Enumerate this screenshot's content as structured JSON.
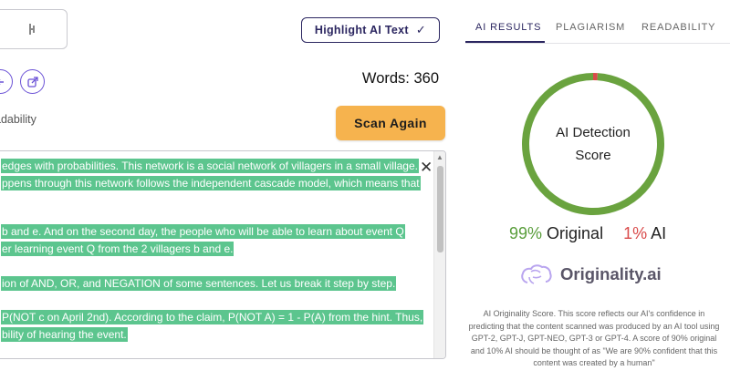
{
  "toolbar": {
    "highlight_label": "Highlight AI Text",
    "highlight_icon": "check-icon",
    "word_count": "Words: 360",
    "tab_fragment": "adability",
    "scan_label": "Scan Again"
  },
  "editor": {
    "lines": [
      "edges with probabilities. This network is a social network of villagers in a small village.",
      "ppens through this network follows the independent cascade model, which means that",
      "b and e. And on the second day, the people who will be able to learn about event Q",
      "er learning event Q from the 2 villagers b and e.",
      "ion of AND, OR, and NEGATION of some sentences. Let us break it step by step.",
      "P(NOT c on April 2nd). According to the claim, P(NOT A) = 1 - P(A) from the hint. Thus,",
      "bility of hearing the event."
    ],
    "highlight_color": "#5cc58e"
  },
  "results": {
    "tabs": [
      "AI RESULTS",
      "PLAGIARISM",
      "READABILITY"
    ],
    "active_tab": "AI RESULTS",
    "gauge_title": [
      "AI Detection",
      "Score"
    ],
    "original_pct": "99%",
    "original_label": "Original",
    "ai_pct": "1%",
    "ai_label": "AI",
    "original_fraction": 0.99,
    "ai_fraction": 0.01,
    "original_color": "#6aa33f",
    "ai_color": "#d94a4a",
    "brand": "Originality.ai",
    "description": "AI Originality Score. This score reflects our AI's confidence in predicting that the content scanned was produced by an AI tool using GPT-2, GPT-J, GPT-NEO, GPT-3 or GPT-4. A score of 90% original and 10% AI should be thought of as \"We are 90% confident that this content was created by a human\""
  },
  "colors": {
    "brand_dark": "#2b2660",
    "accent_orange": "#f6b34e",
    "icon_purple": "#6b52d6"
  }
}
